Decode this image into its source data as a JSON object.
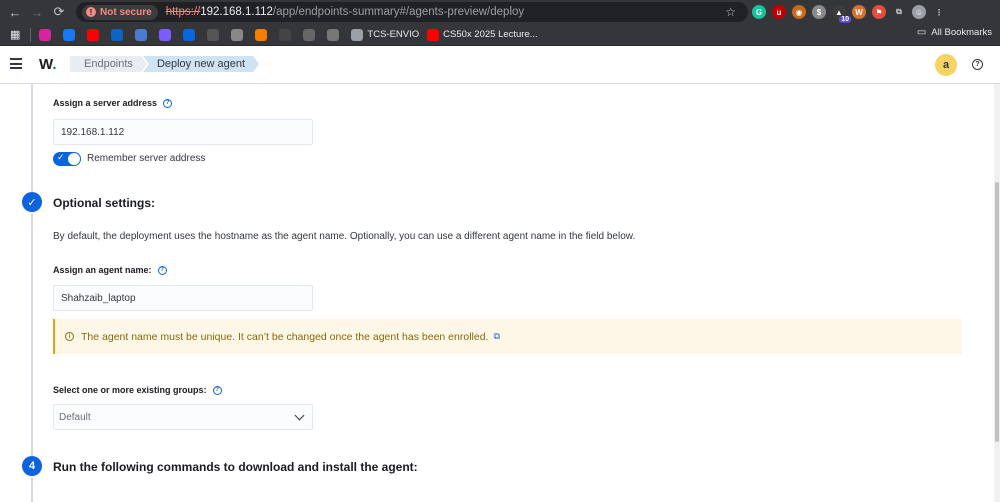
{
  "browser": {
    "security_label": "Not secure",
    "url_protocol": "https://",
    "url_host": "192.168.1.112",
    "url_path": "/app/endpoints-summary#/agents-preview/deploy",
    "extensions": [
      {
        "name": "grammarly-extension",
        "color": "#15c39a",
        "glyph": "G"
      },
      {
        "name": "ublock-extension",
        "color": "#c00000",
        "glyph": "u"
      },
      {
        "name": "cookie-extension",
        "color": "#c66a1d",
        "glyph": "◉"
      },
      {
        "name": "dollar-extension",
        "color": "#8a8a8a",
        "glyph": "$"
      },
      {
        "name": "badge-extension",
        "color": "#3c3c3c",
        "glyph": "▲",
        "badge": "10"
      },
      {
        "name": "wappalyzer-extension",
        "color": "#d9702e",
        "glyph": "W"
      },
      {
        "name": "tracker-extension",
        "color": "#e34c3c",
        "glyph": "⚑"
      }
    ]
  },
  "bookmarks": {
    "items": [
      {
        "label": "",
        "icon": "instagram-icon",
        "color": "#d6249f"
      },
      {
        "label": "",
        "icon": "facebook-icon",
        "color": "#1877f2"
      },
      {
        "label": "",
        "icon": "youtube-icon",
        "color": "#ff0000"
      },
      {
        "label": "",
        "icon": "linkedin-icon",
        "color": "#0a66c2"
      },
      {
        "label": "",
        "icon": "search-bm-icon",
        "color": "#4a7bd0"
      },
      {
        "label": "",
        "icon": "hackerone-icon",
        "color": "#7b5cff"
      },
      {
        "label": "",
        "icon": "meta-icon",
        "color": "#0668e1"
      },
      {
        "label": "",
        "icon": "notion-icon",
        "color": "#555555"
      },
      {
        "label": "",
        "icon": "record-icon",
        "color": "#888888"
      },
      {
        "label": "",
        "icon": "blogger-icon",
        "color": "#f57d00"
      },
      {
        "label": "",
        "icon": "hash-icon",
        "color": "#444444"
      },
      {
        "label": "",
        "icon": "image-bm-icon",
        "color": "#666666"
      },
      {
        "label": "",
        "icon": "docs-icon",
        "color": "#777777"
      },
      {
        "label": "TCS-ENVIO",
        "icon": "globe-icon",
        "color": "#9aa0a6"
      },
      {
        "label": "CS50x 2025 Lecture...",
        "icon": "youtube-icon",
        "color": "#ff0000"
      }
    ],
    "all_label": "All Bookmarks"
  },
  "header": {
    "logo": "W",
    "breadcrumbs": [
      "Endpoints",
      "Deploy new agent"
    ],
    "avatar_letter": "a",
    "help_glyph": "?"
  },
  "form": {
    "server_address_label": "Assign a server address",
    "server_address_value": "192.168.1.112",
    "remember_label": "Remember server address",
    "optional_title": "Optional settings:",
    "optional_description": "By default, the deployment uses the hostname as the agent name. Optionally, you can use a different agent name in the field below.",
    "agent_name_label": "Assign an agent name:",
    "agent_name_value": "Shahzaib_laptop",
    "callout_text": "The agent name must be unique. It can’t be changed once the agent has been enrolled.",
    "groups_label": "Select one or more existing groups:",
    "groups_value": "Default",
    "step4_number": "4",
    "step4_title": "Run the following commands to download and install the agent:"
  },
  "colors": {
    "accent": "#0b64dd",
    "warning_text": "#8a6a0a",
    "warning_bg": "#fef6e6"
  }
}
